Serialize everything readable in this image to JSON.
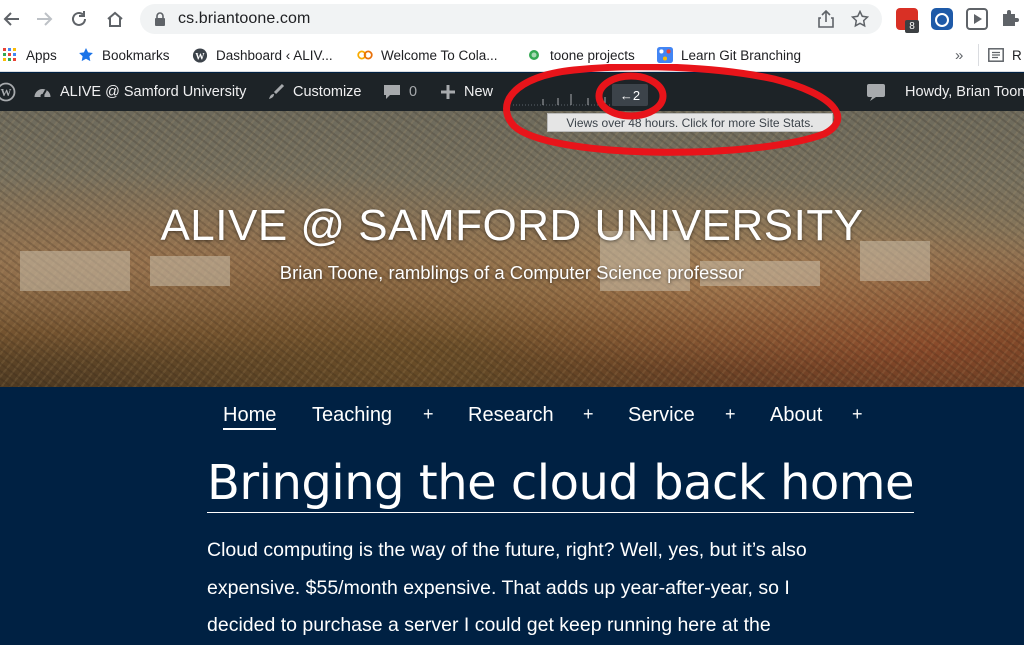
{
  "browser": {
    "url": "cs.briantoone.com",
    "extension_badge": "8",
    "bookmarks": [
      {
        "label": "Apps",
        "icon": "apps-grid-icon"
      },
      {
        "label": "Bookmarks",
        "icon": "star-icon"
      },
      {
        "label": "Dashboard ‹ ALIV...",
        "icon": "wordpress-icon"
      },
      {
        "label": "Welcome To Cola...",
        "icon": "colab-icon"
      },
      {
        "label": "toone projects",
        "icon": "green-dot-icon"
      },
      {
        "label": "Learn Git Branching",
        "icon": "git-branch-icon"
      }
    ],
    "bookmarks_overflow": "»",
    "reading_list_label": "R"
  },
  "adminbar": {
    "site_name": "ALIVE @ Samford University",
    "customize": "Customize",
    "comments_count": "0",
    "new": "New",
    "stats_value": "2",
    "stats_tooltip": "Views over 48 hours. Click for more Site Stats.",
    "howdy": "Howdy, Brian Toone"
  },
  "hero": {
    "title": "ALIVE @ SAMFORD UNIVERSITY",
    "tagline": "Brian Toone, ramblings of a Computer Science professor"
  },
  "nav": {
    "items": [
      {
        "label": "Home",
        "active": true,
        "submenu": false
      },
      {
        "label": "Teaching",
        "active": false,
        "submenu": true
      },
      {
        "label": "Research",
        "active": false,
        "submenu": true
      },
      {
        "label": "Service",
        "active": false,
        "submenu": true
      },
      {
        "label": "About",
        "active": false,
        "submenu": true
      }
    ],
    "submenu_toggle": "+"
  },
  "post": {
    "title": "Bringing the cloud back home",
    "body_lines": [
      "Cloud computing is the way of the future, right? Well, yes, but it’s also",
      "expensive. $55/month expensive. That adds up year-after-year, so I",
      "decided to purchase a server I could get keep running here at the"
    ]
  },
  "colors": {
    "adminbar_bg": "#1d2327",
    "page_bg": "#002143",
    "annotation_red": "#e8141a"
  }
}
